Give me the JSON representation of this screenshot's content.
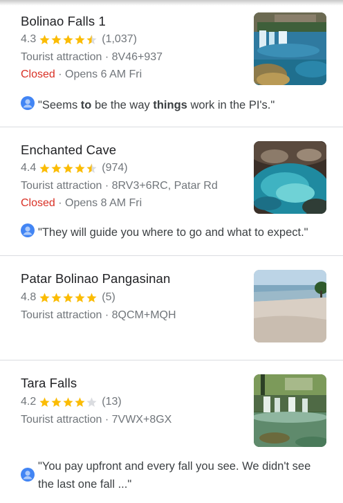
{
  "colors": {
    "star": "#fbbc04",
    "star_empty": "#dadce0",
    "closed": "#d93025",
    "secondary_text": "#70757a",
    "avatar": "#4285f4"
  },
  "places": [
    {
      "name": "Bolinao Falls 1",
      "rating": "4.3",
      "stars": 4.3,
      "reviews_count": "(1,037)",
      "category": "Tourist attraction",
      "separator": "·",
      "plus_code": "8V46+937",
      "status": "Closed",
      "opens": "· Opens 6 AM Fri",
      "review": {
        "pre": "\"Seems ",
        "b1": "to",
        "mid": " be the way ",
        "b2": "things",
        "post": " work in the PI's.\""
      },
      "thumbnail": "waterfall-photo"
    },
    {
      "name": "Enchanted Cave",
      "rating": "4.4",
      "stars": 4.4,
      "reviews_count": "(974)",
      "category": "Tourist attraction",
      "separator": "·",
      "plus_code": "8RV3+6RC, Patar Rd",
      "status": "Closed",
      "opens": "· Opens 8 AM Fri",
      "review": {
        "text": "\"They will guide you where to go and what to expect.\""
      },
      "thumbnail": "cave-pool-photo"
    },
    {
      "name": "Patar Bolinao Pangasinan",
      "rating": "4.8",
      "stars": 4.8,
      "reviews_count": "(5)",
      "category": "Tourist attraction",
      "separator": "·",
      "plus_code": "8QCM+MQH",
      "thumbnail": "beach-photo"
    },
    {
      "name": "Tara Falls",
      "rating": "4.2",
      "stars": 4.2,
      "reviews_count": "(13)",
      "category": "Tourist attraction",
      "separator": "·",
      "plus_code": "7VWX+8GX",
      "review": {
        "text": "\"You pay upfront and every fall you see. We didn't see the last one fall ...\""
      },
      "thumbnail": "falls-photo"
    }
  ]
}
